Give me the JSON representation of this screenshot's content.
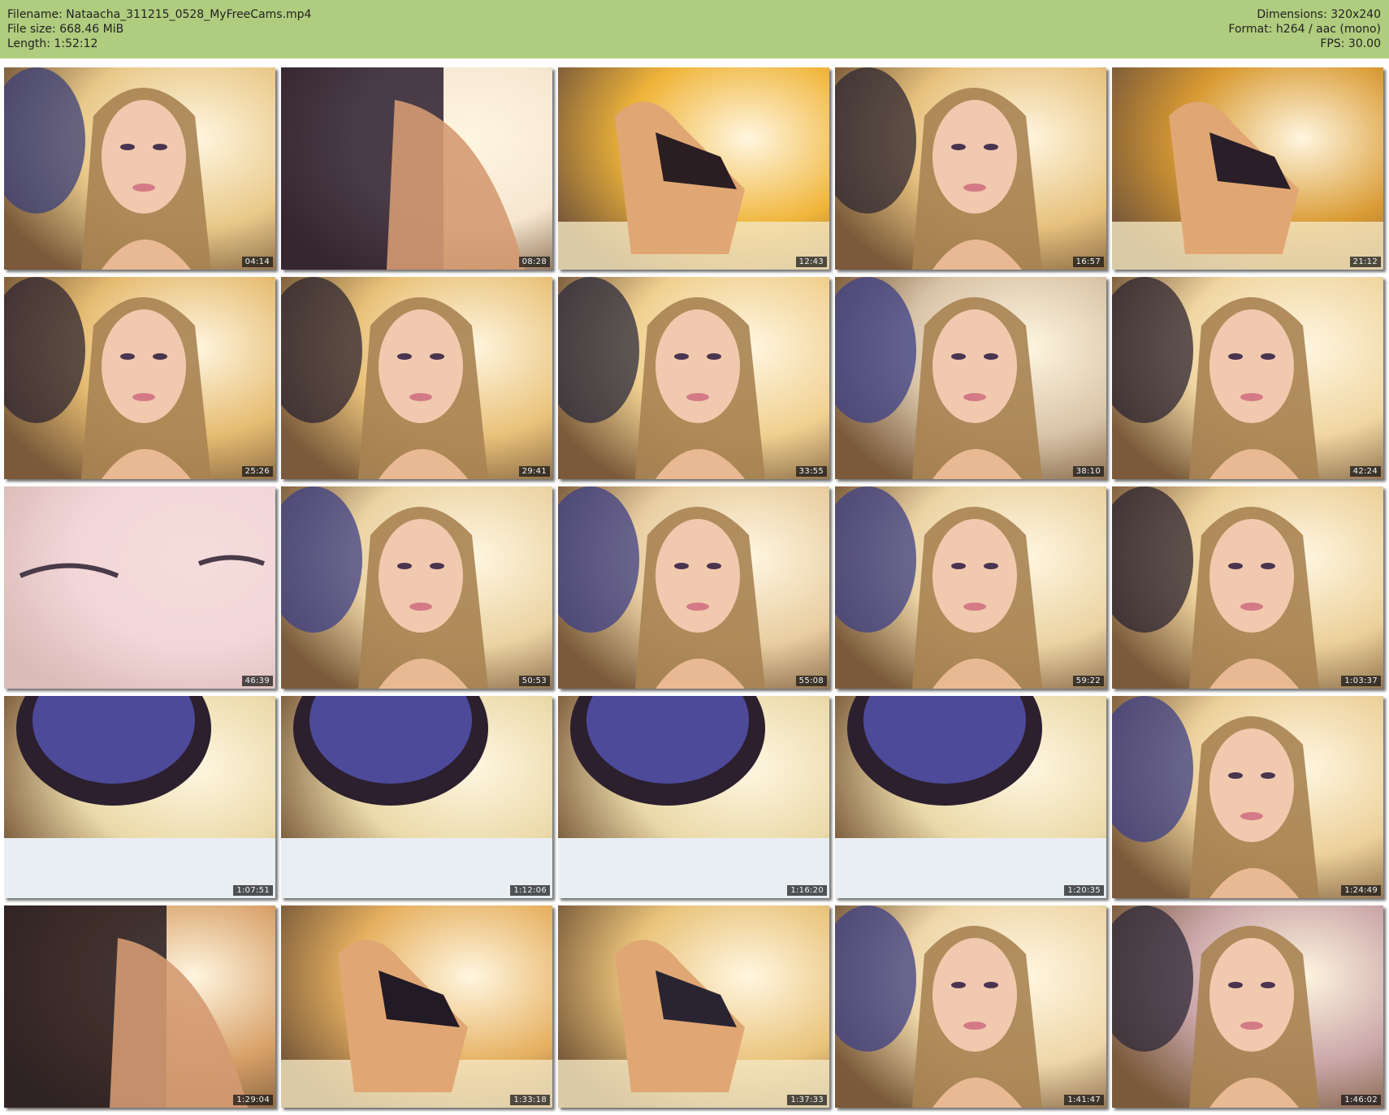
{
  "header": {
    "left": [
      "Filename: Nataacha_311215_0528_MyFreeCams.mp4",
      "File size: 668.46 MiB",
      "Length: 1:52:12"
    ],
    "right": [
      "Dimensions: 320x240",
      "Format: h264 / aac (mono)",
      "FPS: 30.00"
    ]
  },
  "thumbnails": [
    {
      "time": "04:14",
      "scene": "face",
      "bg": "#e9c98a",
      "accent": "#3a3f7a"
    },
    {
      "time": "08:28",
      "scene": "dark",
      "bg": "#f6e6d0",
      "accent": "#2a1d2e"
    },
    {
      "time": "12:43",
      "scene": "body",
      "bg": "#f0b53a",
      "accent": "#2a1e22"
    },
    {
      "time": "16:57",
      "scene": "face",
      "bg": "#e7c27e",
      "accent": "#2e2732"
    },
    {
      "time": "21:12",
      "scene": "body",
      "bg": "#d99a32",
      "accent": "#2a1e28"
    },
    {
      "time": "25:26",
      "scene": "face",
      "bg": "#e6bc72",
      "accent": "#2c2430"
    },
    {
      "time": "29:41",
      "scene": "face",
      "bg": "#e9c27a",
      "accent": "#2c2430"
    },
    {
      "time": "33:55",
      "scene": "face",
      "bg": "#f0d090",
      "accent": "#2b2b3c"
    },
    {
      "time": "38:10",
      "scene": "face",
      "bg": "#d9c4a8",
      "accent": "#3b3f86"
    },
    {
      "time": "42:24",
      "scene": "face",
      "bg": "#f0d6a2",
      "accent": "#2c2430"
    },
    {
      "time": "46:39",
      "scene": "closeup",
      "bg": "#f2d6d8",
      "accent": "#4a3b4a"
    },
    {
      "time": "50:53",
      "scene": "face",
      "bg": "#ebd3a3",
      "accent": "#3c3f86"
    },
    {
      "time": "55:08",
      "scene": "face",
      "bg": "#e8cda0",
      "accent": "#3c3f86"
    },
    {
      "time": "59:22",
      "scene": "face",
      "bg": "#ebd3a3",
      "accent": "#3c3f86"
    },
    {
      "time": "1:03:37",
      "scene": "face",
      "bg": "#ecd09a",
      "accent": "#2c2430"
    },
    {
      "time": "1:07:51",
      "scene": "mirror",
      "bg": "#ead9a8",
      "accent": "#4d4a9a"
    },
    {
      "time": "1:12:06",
      "scene": "mirror",
      "bg": "#ead9a8",
      "accent": "#4d4a9a"
    },
    {
      "time": "1:16:20",
      "scene": "mirror",
      "bg": "#ead9a8",
      "accent": "#4d4a9a"
    },
    {
      "time": "1:20:35",
      "scene": "mirror",
      "bg": "#ead9a8",
      "accent": "#4d4a9a"
    },
    {
      "time": "1:24:49",
      "scene": "face",
      "bg": "#ecd09a",
      "accent": "#3c3f86"
    },
    {
      "time": "1:29:04",
      "scene": "dark",
      "bg": "#d8a068",
      "accent": "#231a20"
    },
    {
      "time": "1:33:18",
      "scene": "body",
      "bg": "#e6b060",
      "accent": "#221a24"
    },
    {
      "time": "1:37:33",
      "scene": "body",
      "bg": "#e9c37a",
      "accent": "#2a2432"
    },
    {
      "time": "1:41:47",
      "scene": "face",
      "bg": "#eed6a8",
      "accent": "#3c3f86"
    },
    {
      "time": "1:46:02",
      "scene": "face",
      "bg": "#caa6a8",
      "accent": "#2e2838"
    }
  ]
}
